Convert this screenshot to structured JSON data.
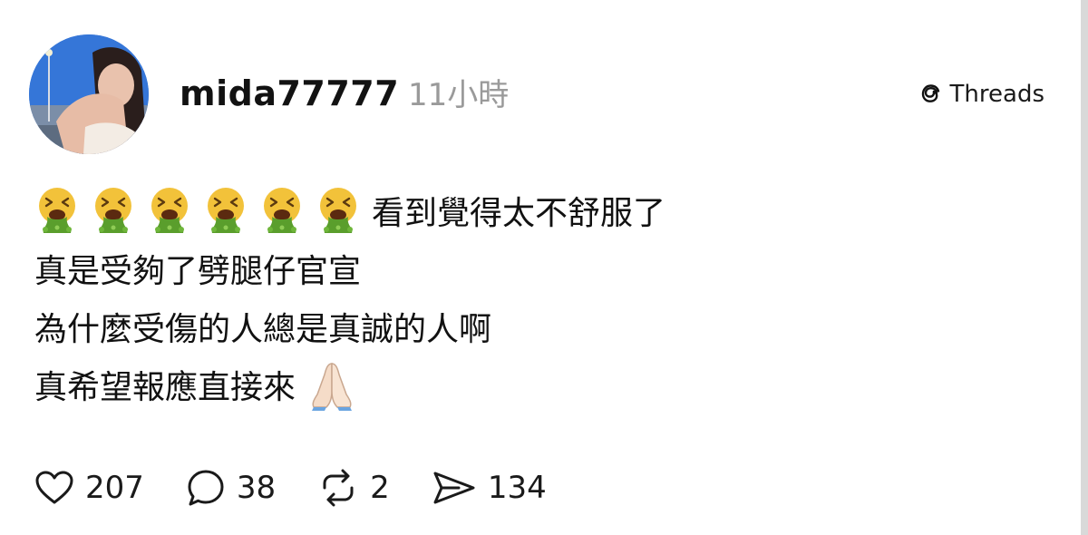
{
  "post": {
    "author": "mida77777",
    "time": "11小時",
    "brand": "Threads",
    "emoji_icon": "nauseated-vomiting-face-icon",
    "emoji_count": 6,
    "lines": [
      "看到覺得太不舒服了",
      "真是受夠了劈腿仔官宣",
      "為什麼受傷的人總是真誠的人啊",
      "真希望報應直接來"
    ],
    "trailing_icon": "folded-hands-icon"
  },
  "actions": {
    "likes": "207",
    "comments": "38",
    "reposts": "2",
    "shares": "134"
  },
  "colors": {
    "text": "#111111",
    "muted": "#9a9a9a",
    "emoji_face": "#f2c23a",
    "emoji_vomit": "#5a9e2c"
  }
}
